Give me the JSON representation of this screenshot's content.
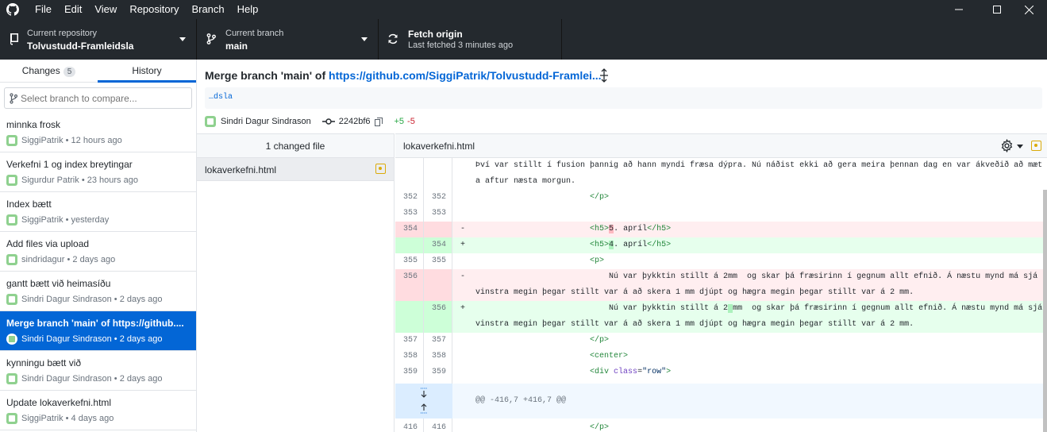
{
  "menu": [
    "File",
    "Edit",
    "View",
    "Repository",
    "Branch",
    "Help"
  ],
  "toolbar": {
    "repo_label": "Current repository",
    "repo_value": "Tolvustudd-Framleidsla",
    "branch_label": "Current branch",
    "branch_value": "main",
    "fetch_label": "Fetch origin",
    "fetch_value": "Last fetched 3 minutes ago"
  },
  "sidebar": {
    "tab_changes": "Changes",
    "tab_changes_count": "5",
    "tab_history": "History",
    "filter_placeholder": "Select branch to compare...",
    "commits": [
      {
        "title": "minnka frosk",
        "author": "SiggiPatrik",
        "time": "12 hours ago"
      },
      {
        "title": "Verkefni 1 og index breytingar",
        "author": "Sigurdur Patrik",
        "time": "23 hours ago"
      },
      {
        "title": "Index bætt",
        "author": "SiggiPatrik",
        "time": "yesterday"
      },
      {
        "title": "Add files via upload",
        "author": "sindridagur",
        "time": "2 days ago"
      },
      {
        "title": "gantt bætt við heimasíðu",
        "author": "Sindri Dagur Sindrason",
        "time": "2 days ago"
      },
      {
        "title": "Merge branch 'main' of https://github....",
        "author": "Sindri Dagur Sindrason",
        "time": "2 days ago",
        "selected": true
      },
      {
        "title": "kynningu bætt við",
        "author": "Sindri Dagur Sindrason",
        "time": "2 days ago"
      },
      {
        "title": "Update lokaverkefni.html",
        "author": "SiggiPatrik",
        "time": "4 days ago"
      }
    ]
  },
  "header": {
    "title_prefix": "Merge branch 'main' of ",
    "title_link": "https://github.com/SiggiPatrik/Tolvustudd-Framlei...",
    "description": "…dsla",
    "author": "Sindri Dagur Sindrason",
    "sha": "2242bf6",
    "additions": "+5",
    "deletions": "-5"
  },
  "files": {
    "header": "1 changed file",
    "items": [
      "lokaverkefni.html"
    ]
  },
  "diff": {
    "filename": "lokaverkefni.html",
    "hunk": "@@ -416,7 +416,7 @@",
    "lines": {
      "l0_code": "Því var stillt í fusion þannig að hann myndi fræsa dýpra. Nú náðist ekki að gera meira þennan dag en var ákveðið að mæta aftur næsta morgun.",
      "l1_o": "352",
      "l1_n": "352",
      "l2_o": "353",
      "l2_n": "353",
      "l3_o": "354",
      "l4_n": "354",
      "l5_o": "355",
      "l5_n": "355",
      "l6_o": "356",
      "l7_n": "356",
      "l8_o": "357",
      "l8_n": "357",
      "l9_o": "358",
      "l9_n": "358",
      "l10_o": "359",
      "l10_n": "359",
      "l11_o": "416",
      "l11_n": "416"
    }
  },
  "colors": {
    "accent": "#0366d6",
    "titlebar": "#24292e",
    "added": "#28a745",
    "deleted": "#cb2431",
    "modified": "#dbab09"
  }
}
